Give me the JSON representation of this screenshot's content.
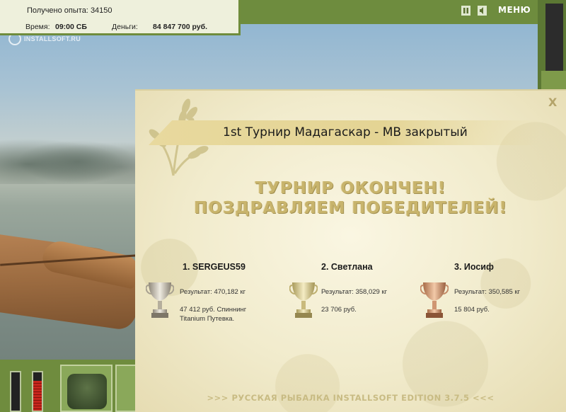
{
  "status": {
    "experience_label": "Получено опыта:",
    "experience_value": "34150",
    "time_label": "Время:",
    "time_value": "09:00 СБ",
    "money_label": "Деньги:",
    "money_value": "84 847 700 руб."
  },
  "watermark": "INSTALLSOFT.RU",
  "topbar": {
    "pause_icon": "pause-icon",
    "sound_icon": "sound-icon",
    "menu_label": "МЕНЮ"
  },
  "dialog": {
    "close_label": "X",
    "title": "1st Турнир Мадагаскар - МВ закрытый",
    "headline_1": "ТУРНИР ОКОНЧЕН!",
    "headline_2": "ПОЗДРАВЛЯЕМ ПОБЕДИТЕЛЕЙ!",
    "winners": [
      {
        "place_name": "1. SERGEUS59",
        "result": "Результат: 470,182 кг",
        "prize_line1": "47 412 руб. Спиннинг",
        "prize_line2": "Titanium Путевка.",
        "cup": "silver"
      },
      {
        "place_name": "2. Светлана",
        "result": "Результат: 358,029 кг",
        "prize_line1": "23 706 руб.",
        "prize_line2": "",
        "cup": "gold"
      },
      {
        "place_name": "3. Иосиф",
        "result": "Результат: 350,585 кг",
        "prize_line1": "15 804 руб.",
        "prize_line2": "",
        "cup": "bronze"
      }
    ],
    "footer": ">>> РУССКАЯ РЫБАЛКА INSTALLSOFT EDITION 3.7.5 <<<"
  },
  "hud": {
    "gauge_left_level": 0.0,
    "gauge_right_level": 0.78
  },
  "colors": {
    "panel_green": "#6f8c3e",
    "dialog_bg": "#f1ebcc",
    "headline": "#c8b46c",
    "gold_cup": "#d9c27a",
    "silver_cup": "#c9c2b0",
    "bronze_cup": "#d9a27a"
  }
}
